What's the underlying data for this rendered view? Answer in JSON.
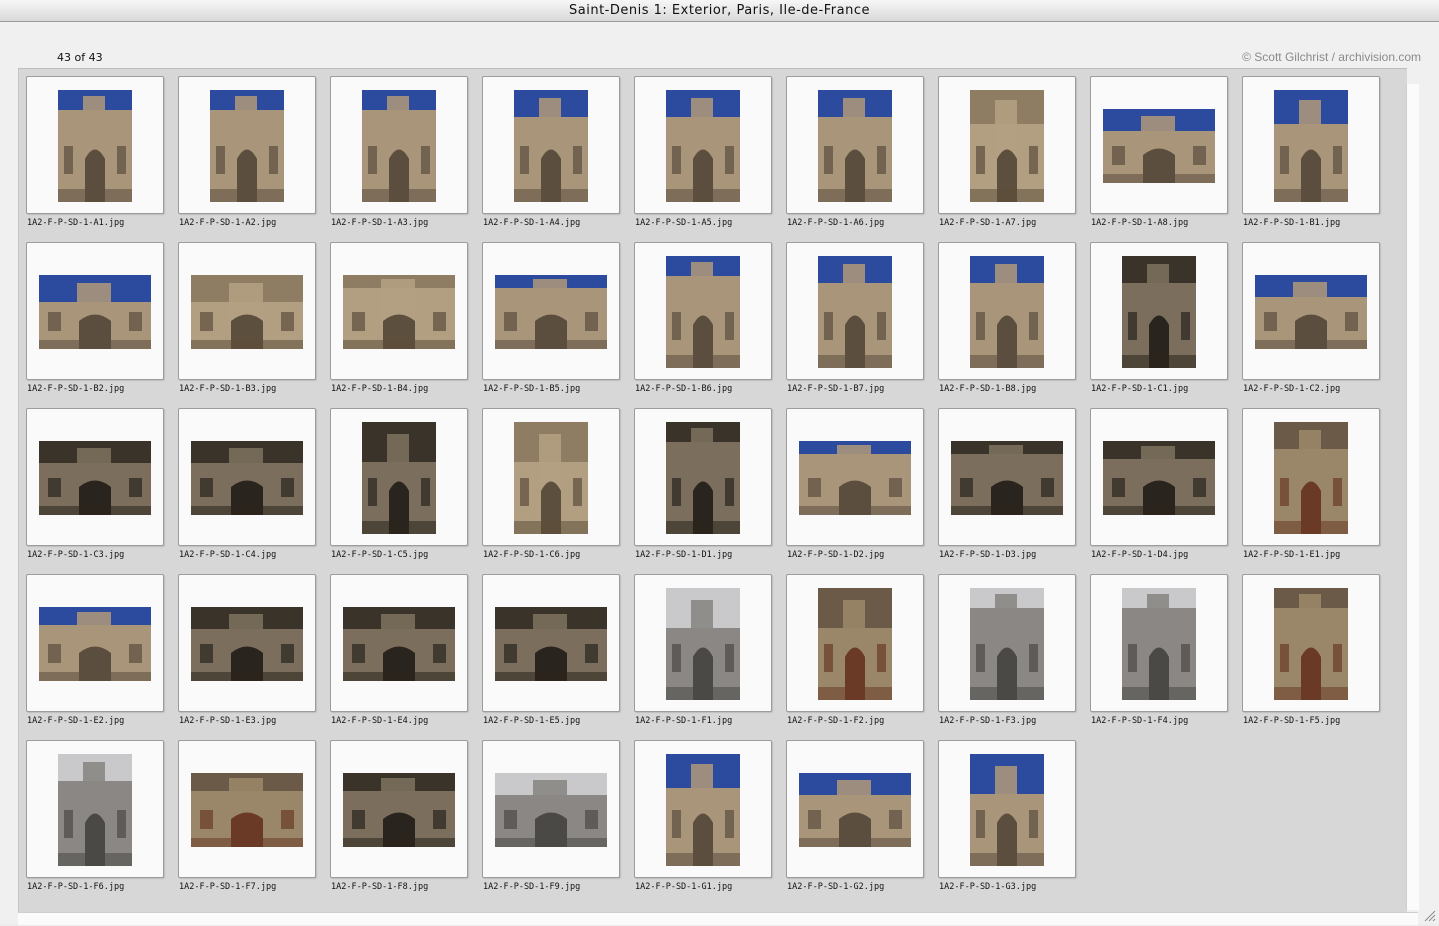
{
  "window": {
    "title": "Saint-Denis 1: Exterior, Paris, Ile-de-France",
    "count": "43 of 43",
    "credit": "© Scott Gilchrist / archivision.com"
  },
  "palettes": {
    "sky": {
      "sky": "#2c4a9e",
      "stone": "#a8957a",
      "shade": "#5b4e3e"
    },
    "stone": {
      "sky": "#8e7d63",
      "stone": "#b29f81",
      "shade": "#5d4f3d"
    },
    "dark": {
      "sky": "#3a332a",
      "stone": "#7b6e5c",
      "shade": "#2a241e"
    },
    "grey": {
      "sky": "#c9c9cc",
      "stone": "#8a8784",
      "shade": "#4b4946"
    },
    "door": {
      "sky": "#6b5a47",
      "stone": "#9a8668",
      "shade": "#6a3a26"
    }
  },
  "thumbnails": [
    {
      "file": "1A2-F-P-SD-1-A1.jpg",
      "orient": "p",
      "palette": "sky"
    },
    {
      "file": "1A2-F-P-SD-1-A2.jpg",
      "orient": "p",
      "palette": "sky"
    },
    {
      "file": "1A2-F-P-SD-1-A3.jpg",
      "orient": "p",
      "palette": "sky"
    },
    {
      "file": "1A2-F-P-SD-1-A4.jpg",
      "orient": "p",
      "palette": "sky"
    },
    {
      "file": "1A2-F-P-SD-1-A5.jpg",
      "orient": "p",
      "palette": "sky"
    },
    {
      "file": "1A2-F-P-SD-1-A6.jpg",
      "orient": "p",
      "palette": "sky"
    },
    {
      "file": "1A2-F-P-SD-1-A7.jpg",
      "orient": "p",
      "palette": "stone"
    },
    {
      "file": "1A2-F-P-SD-1-A8.jpg",
      "orient": "l",
      "palette": "sky"
    },
    {
      "file": "1A2-F-P-SD-1-B1.jpg",
      "orient": "p",
      "palette": "sky"
    },
    {
      "file": "1A2-F-P-SD-1-B2.jpg",
      "orient": "l",
      "palette": "sky"
    },
    {
      "file": "1A2-F-P-SD-1-B3.jpg",
      "orient": "l",
      "palette": "stone"
    },
    {
      "file": "1A2-F-P-SD-1-B4.jpg",
      "orient": "l",
      "palette": "stone"
    },
    {
      "file": "1A2-F-P-SD-1-B5.jpg",
      "orient": "l",
      "palette": "sky"
    },
    {
      "file": "1A2-F-P-SD-1-B6.jpg",
      "orient": "p",
      "palette": "sky"
    },
    {
      "file": "1A2-F-P-SD-1-B7.jpg",
      "orient": "p",
      "palette": "sky"
    },
    {
      "file": "1A2-F-P-SD-1-B8.jpg",
      "orient": "p",
      "palette": "sky"
    },
    {
      "file": "1A2-F-P-SD-1-C1.jpg",
      "orient": "p",
      "palette": "dark"
    },
    {
      "file": "1A2-F-P-SD-1-C2.jpg",
      "orient": "l",
      "palette": "sky"
    },
    {
      "file": "1A2-F-P-SD-1-C3.jpg",
      "orient": "l",
      "palette": "dark"
    },
    {
      "file": "1A2-F-P-SD-1-C4.jpg",
      "orient": "l",
      "palette": "dark"
    },
    {
      "file": "1A2-F-P-SD-1-C5.jpg",
      "orient": "p",
      "palette": "dark"
    },
    {
      "file": "1A2-F-P-SD-1-C6.jpg",
      "orient": "p",
      "palette": "stone"
    },
    {
      "file": "1A2-F-P-SD-1-D1.jpg",
      "orient": "p",
      "palette": "dark"
    },
    {
      "file": "1A2-F-P-SD-1-D2.jpg",
      "orient": "l",
      "palette": "sky"
    },
    {
      "file": "1A2-F-P-SD-1-D3.jpg",
      "orient": "l",
      "palette": "dark"
    },
    {
      "file": "1A2-F-P-SD-1-D4.jpg",
      "orient": "l",
      "palette": "dark"
    },
    {
      "file": "1A2-F-P-SD-1-E1.jpg",
      "orient": "p",
      "palette": "door"
    },
    {
      "file": "1A2-F-P-SD-1-E2.jpg",
      "orient": "l",
      "palette": "sky"
    },
    {
      "file": "1A2-F-P-SD-1-E3.jpg",
      "orient": "l",
      "palette": "dark"
    },
    {
      "file": "1A2-F-P-SD-1-E4.jpg",
      "orient": "l",
      "palette": "dark"
    },
    {
      "file": "1A2-F-P-SD-1-E5.jpg",
      "orient": "l",
      "palette": "dark"
    },
    {
      "file": "1A2-F-P-SD-1-F1.jpg",
      "orient": "p",
      "palette": "grey"
    },
    {
      "file": "1A2-F-P-SD-1-F2.jpg",
      "orient": "p",
      "palette": "door"
    },
    {
      "file": "1A2-F-P-SD-1-F3.jpg",
      "orient": "p",
      "palette": "grey"
    },
    {
      "file": "1A2-F-P-SD-1-F4.jpg",
      "orient": "p",
      "palette": "grey"
    },
    {
      "file": "1A2-F-P-SD-1-F5.jpg",
      "orient": "p",
      "palette": "door"
    },
    {
      "file": "1A2-F-P-SD-1-F6.jpg",
      "orient": "p",
      "palette": "grey"
    },
    {
      "file": "1A2-F-P-SD-1-F7.jpg",
      "orient": "l",
      "palette": "door"
    },
    {
      "file": "1A2-F-P-SD-1-F8.jpg",
      "orient": "l",
      "palette": "dark"
    },
    {
      "file": "1A2-F-P-SD-1-F9.jpg",
      "orient": "l",
      "palette": "grey"
    },
    {
      "file": "1A2-F-P-SD-1-G1.jpg",
      "orient": "p",
      "palette": "sky"
    },
    {
      "file": "1A2-F-P-SD-1-G2.jpg",
      "orient": "l",
      "palette": "sky"
    },
    {
      "file": "1A2-F-P-SD-1-G3.jpg",
      "orient": "p",
      "palette": "sky"
    }
  ]
}
